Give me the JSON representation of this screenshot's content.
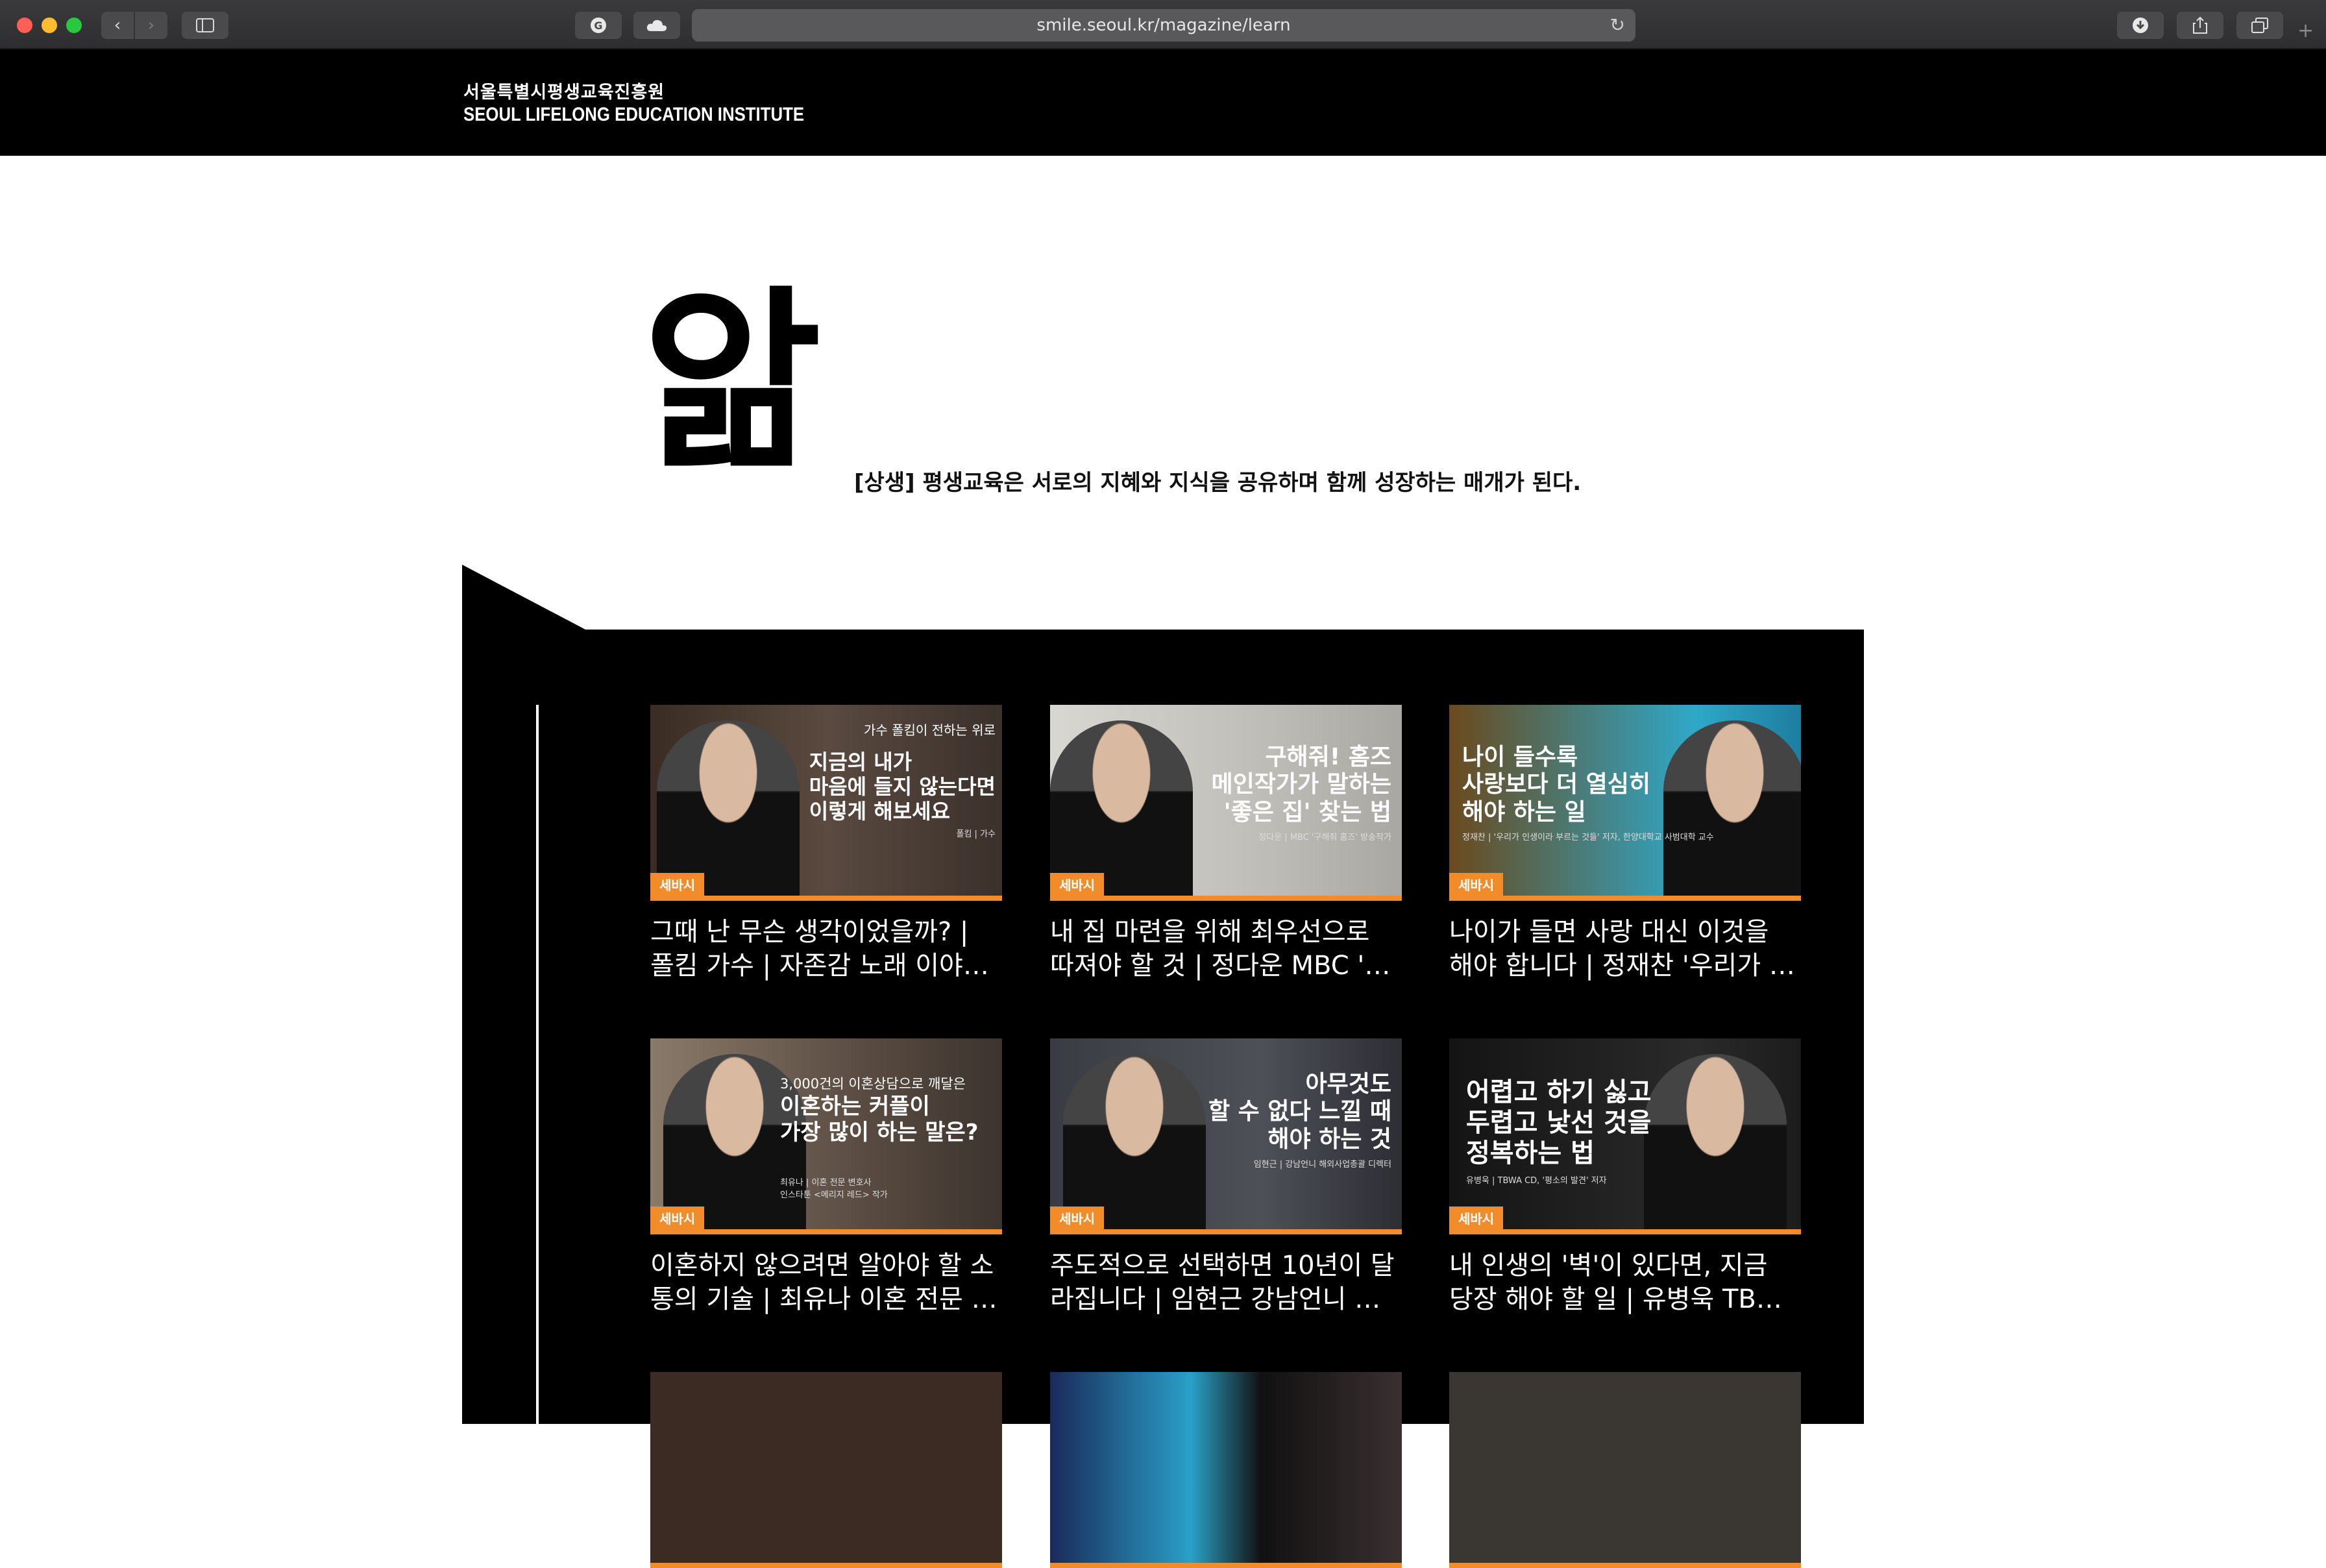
{
  "browser": {
    "url": "smile.seoul.kr/magazine/learn",
    "back_icon": "chevron-left",
    "forward_icon": "chevron-right",
    "reload_icon": "reload",
    "plus_icon": "plus"
  },
  "header": {
    "logo_ko": "서울특별시평생교육진흥원",
    "logo_en": "SEOUL LIFELONG EDUCATION INSTITUTE"
  },
  "page": {
    "title": "앎",
    "subtitle": "[상생] 평생교육은 서로의 지혜와 지식을 공유하며 함께 성장하는 매개가 된다."
  },
  "colors": {
    "accent": "#f28c2a",
    "panel": "#000000"
  },
  "videos": [
    {
      "thumb_small_top": "가수 폴킴이 전하는 위로",
      "thumb_text": "지금의 내가\n마음에 들지 않는다면\n이렇게 해보세요",
      "thumb_footer": "폴킴 | 가수",
      "badge": "세바시",
      "caption": "그때 난 무슨 생각이었을까? |\n폴킴 가수 | 자존감 노래 이야…"
    },
    {
      "thumb_small_top": "",
      "thumb_text": "구해줘! 홈즈\n메인작가가 말하는\n'좋은 집' 찾는 법",
      "thumb_footer": "정다운 | MBC '구해줘 홈즈' 방송작가",
      "badge": "세바시",
      "caption": "내 집 마련을 위해 최우선으로\n따져야 할 것 | 정다운 MBC '…"
    },
    {
      "thumb_small_top": "",
      "thumb_text": "나이 들수록\n사랑보다 더 열심히\n해야 하는 일",
      "thumb_footer": "정재찬 | '우리가 인생이라 부르는 것들' 저자, 한양대학교 사범대학 교수",
      "badge": "세바시",
      "caption": "나이가 들면 사랑 대신 이것을\n해야 합니다 | 정재찬 '우리가 …"
    },
    {
      "thumb_small_top": "3,000건의 이혼상담으로 깨달은",
      "thumb_text": "이혼하는 커플이\n가장 많이 하는 말은?",
      "thumb_footer": "최유나 | 이혼 전문 변호사\n인스타툰 <메리지 레드> 작가",
      "badge": "세바시",
      "caption": "이혼하지 않으려면 알아야 할 소\n통의 기술 | 최유나 이혼 전문 …"
    },
    {
      "thumb_small_top": "",
      "thumb_text": "아무것도\n할 수 없다 느낄 때\n해야 하는 것",
      "thumb_footer": "임현근 | 강남언니 해외사업총괄 디렉터",
      "badge": "세바시",
      "caption": "주도적으로 선택하면 10년이 달\n라집니다 | 임현근 강남언니 …"
    },
    {
      "thumb_small_top": "",
      "thumb_text": "어렵고 하기 싫고\n두렵고 낯선 것을\n정복하는 법",
      "thumb_footer": "유병욱 | TBWA CD, '평소의 발견' 저자",
      "badge": "세바시",
      "caption": "내 인생의 '벽'이 있다면, 지금\n당장 해야 할 일 | 유병욱 TB…"
    }
  ]
}
